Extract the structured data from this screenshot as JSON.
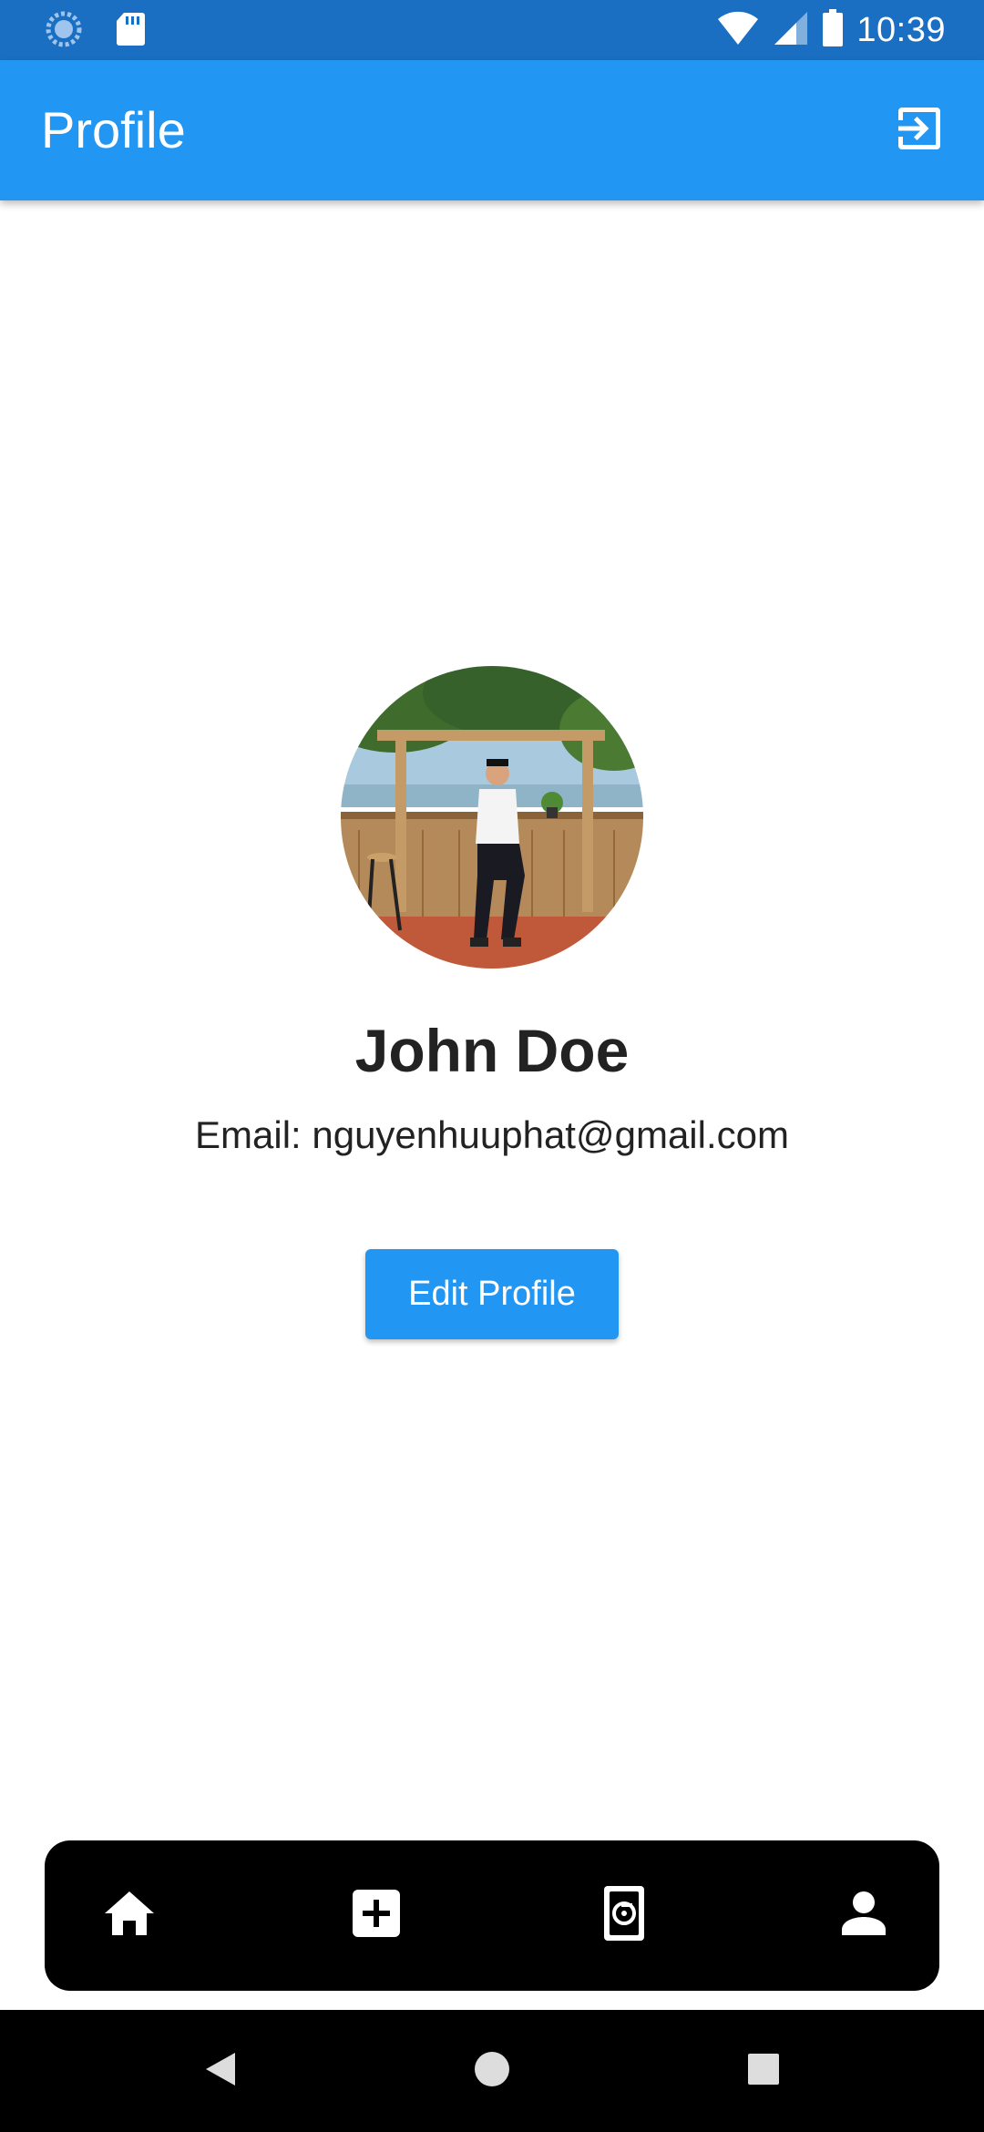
{
  "status_bar": {
    "time": "10:39",
    "icons": [
      "sync-icon",
      "sd-card-icon",
      "wifi-icon",
      "signal-icon",
      "battery-icon"
    ]
  },
  "app_bar": {
    "title": "Profile",
    "action_icon": "logout-icon"
  },
  "profile": {
    "name": "John Doe",
    "email": "Email: nguyenhuuphat@gmail.com",
    "edit_label": "Edit Profile"
  },
  "bottom_nav": {
    "items": [
      {
        "icon": "home-icon"
      },
      {
        "icon": "add-box-icon"
      },
      {
        "icon": "camera-roll-icon"
      },
      {
        "icon": "person-icon"
      }
    ]
  },
  "system_nav": {
    "buttons": [
      "back-icon",
      "home-circle-icon",
      "recents-icon"
    ]
  },
  "colors": {
    "primary": "#2196f3",
    "status_bar": "#1a6fc2",
    "text": "#222222",
    "nav_background": "#000000"
  }
}
